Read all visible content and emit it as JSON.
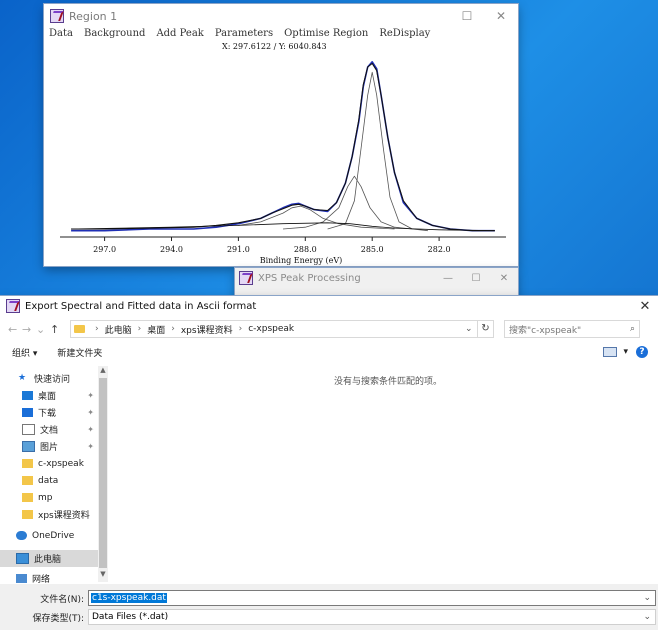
{
  "region_window": {
    "title": "Region 1",
    "menu": [
      "Data",
      "Background",
      "Add Peak",
      "Parameters",
      "Optimise Region",
      "ReDisplay"
    ],
    "coords": "X: 297.6122 / Y: 6040.843",
    "minimize": "☐",
    "close": "✕"
  },
  "chart_data": {
    "type": "line",
    "xlabel": "Binding Energy (eV)",
    "x_reversed": true,
    "xlim": [
      299,
      279
    ],
    "xticks": [
      "297.0",
      "294.0",
      "291.0",
      "288.0",
      "285.0",
      "282.0"
    ],
    "xtick_values": [
      297,
      294,
      291,
      288,
      285,
      282
    ],
    "ylim": [
      0,
      1
    ],
    "y_units": "relative intensity",
    "series": [
      {
        "style": "data",
        "color": "#1f2fb5",
        "x": [
          298.5,
          297,
          295,
          293,
          292,
          291,
          290,
          289.5,
          289,
          288.6,
          288.3,
          288,
          287.6,
          287,
          286.6,
          286.2,
          285.9,
          285.6,
          285.4,
          285.2,
          285.0,
          284.8,
          284.6,
          284.3,
          284,
          283.6,
          283,
          282.3,
          281.5,
          280.5,
          279.5
        ],
        "y": [
          0.03,
          0.03,
          0.04,
          0.04,
          0.05,
          0.07,
          0.1,
          0.13,
          0.16,
          0.18,
          0.185,
          0.17,
          0.15,
          0.14,
          0.19,
          0.3,
          0.45,
          0.65,
          0.85,
          0.96,
          0.99,
          0.95,
          0.8,
          0.56,
          0.36,
          0.19,
          0.1,
          0.06,
          0.04,
          0.03,
          0.03
        ]
      },
      {
        "style": "envelope",
        "color": "#111111",
        "x": [
          298.5,
          297,
          295,
          293,
          292,
          291,
          290,
          289.5,
          289,
          288.6,
          288.3,
          288,
          287.6,
          287,
          286.6,
          286.2,
          285.9,
          285.6,
          285.4,
          285.2,
          285.0,
          284.8,
          284.6,
          284.3,
          284,
          283.6,
          283,
          282.3,
          281.5,
          280.5,
          279.5
        ],
        "y": [
          0.04,
          0.04,
          0.045,
          0.05,
          0.06,
          0.075,
          0.1,
          0.13,
          0.155,
          0.175,
          0.18,
          0.17,
          0.15,
          0.145,
          0.19,
          0.3,
          0.45,
          0.66,
          0.86,
          0.96,
          0.98,
          0.94,
          0.8,
          0.56,
          0.36,
          0.2,
          0.1,
          0.06,
          0.04,
          0.03,
          0.03
        ]
      },
      {
        "style": "peak",
        "color": "#555555",
        "x": [
          291,
          290,
          289,
          288.6,
          288.2,
          287.8,
          287.2,
          286.5,
          285.5,
          284
        ],
        "y": [
          0.06,
          0.08,
          0.13,
          0.16,
          0.17,
          0.15,
          0.1,
          0.07,
          0.05,
          0.04
        ]
      },
      {
        "style": "peak",
        "color": "#555555",
        "x": [
          289,
          288,
          287.2,
          286.5,
          286.1,
          285.8,
          285.5,
          285.1,
          284.6,
          284,
          283.2
        ],
        "y": [
          0.04,
          0.05,
          0.08,
          0.16,
          0.28,
          0.34,
          0.28,
          0.16,
          0.08,
          0.05,
          0.04
        ]
      },
      {
        "style": "peak",
        "color": "#555555",
        "x": [
          287,
          286.2,
          285.8,
          285.5,
          285.2,
          285.0,
          284.8,
          284.5,
          284.2,
          283.8,
          283.2,
          282.5
        ],
        "y": [
          0.04,
          0.07,
          0.2,
          0.5,
          0.8,
          0.93,
          0.8,
          0.5,
          0.22,
          0.08,
          0.04,
          0.03
        ]
      },
      {
        "style": "background",
        "color": "#111111",
        "x": [
          298.5,
          294,
          291,
          289,
          287,
          286,
          285,
          284,
          282,
          279.5
        ],
        "y": [
          0.04,
          0.05,
          0.06,
          0.07,
          0.075,
          0.07,
          0.055,
          0.045,
          0.035,
          0.03
        ]
      }
    ]
  },
  "xps_window": {
    "title": "XPS Peak Processing",
    "minimize": "—",
    "maximize": "☐",
    "close": "✕"
  },
  "dialog": {
    "title": "Export Spectral and Fitted data in Ascii format",
    "close": "✕",
    "nav": {
      "back": "←",
      "forward": "→",
      "dropdown": "⌄",
      "up": "↑"
    },
    "breadcrumb": [
      "此电脑",
      "桌面",
      "xps课程资料",
      "c-xpspeak"
    ],
    "breadcrumb_sep": "›",
    "addr_dropdown": "⌄",
    "refresh": "↻",
    "search_placeholder": "搜索\"c-xpspeak\"",
    "search_icon": "⌕",
    "toolbar": {
      "organize": "组织 ▾",
      "new_folder": "新建文件夹",
      "view_dd": "▾",
      "help": "?"
    },
    "nav_pane": [
      {
        "label": "快速访问",
        "icon": "star",
        "pinned": false,
        "selected": false
      },
      {
        "label": "桌面",
        "icon": "desktop",
        "pinned": true,
        "selected": false
      },
      {
        "label": "下载",
        "icon": "download",
        "pinned": true,
        "selected": false
      },
      {
        "label": "文档",
        "icon": "document",
        "pinned": true,
        "selected": false
      },
      {
        "label": "图片",
        "icon": "picture",
        "pinned": true,
        "selected": false
      },
      {
        "label": "c-xpspeak",
        "icon": "folder",
        "pinned": false,
        "selected": false
      },
      {
        "label": "data",
        "icon": "folder",
        "pinned": false,
        "selected": false
      },
      {
        "label": "mp",
        "icon": "folder",
        "pinned": false,
        "selected": false
      },
      {
        "label": "xps课程资料",
        "icon": "folder",
        "pinned": false,
        "selected": false
      },
      {
        "label": "OneDrive",
        "icon": "cloud",
        "pinned": false,
        "selected": false
      },
      {
        "label": "此电脑",
        "icon": "computer",
        "pinned": false,
        "selected": true
      },
      {
        "label": "网络",
        "icon": "network",
        "pinned": false,
        "selected": false
      }
    ],
    "pin_glyph": "✦",
    "scroll_up": "▲",
    "scroll_down": "▼",
    "empty_message": "没有与搜索条件匹配的项。",
    "filename_label": "文件名(N):",
    "filename_value": "c1s-xpspeak.dat",
    "filetype_label": "保存类型(T):",
    "filetype_value": "Data Files (*.dat)",
    "combo_dd": "⌄"
  }
}
